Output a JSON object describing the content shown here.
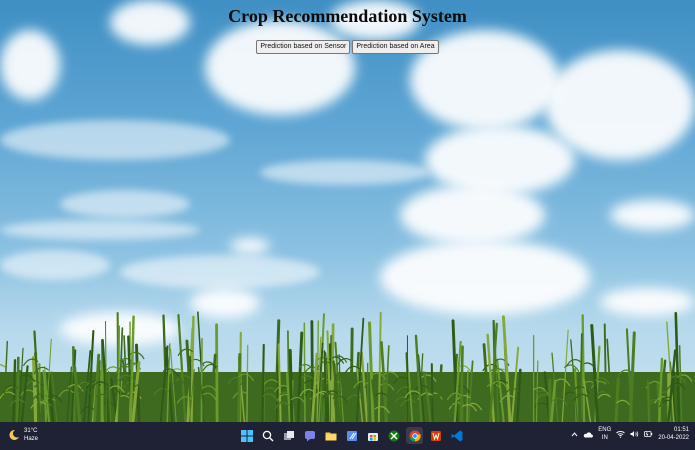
{
  "app": {
    "title": "Crop Recommendation System",
    "buttons": {
      "sensor": "Prediction based on Sensor",
      "area": "Prediction based on Area"
    }
  },
  "taskbar": {
    "weather": {
      "temp": "31°C",
      "condition": "Haze",
      "icon": "moon-cloud-icon"
    },
    "apps": [
      "windows-start-icon",
      "search-icon",
      "task-view-icon",
      "teams-chat-icon",
      "file-explorer-icon",
      "notepad-icon",
      "microsoft-store-icon",
      "xbox-icon",
      "chrome-icon",
      "office-icon",
      "vscode-icon"
    ],
    "tray": {
      "lang_line1": "ENG",
      "lang_line2": "IN",
      "time": "01:51",
      "date": "20-04-2022"
    }
  },
  "colors": {
    "sky_top": "#3f8fc4",
    "sky_bottom": "#c8e2ee",
    "taskbar": "#1f2235"
  }
}
